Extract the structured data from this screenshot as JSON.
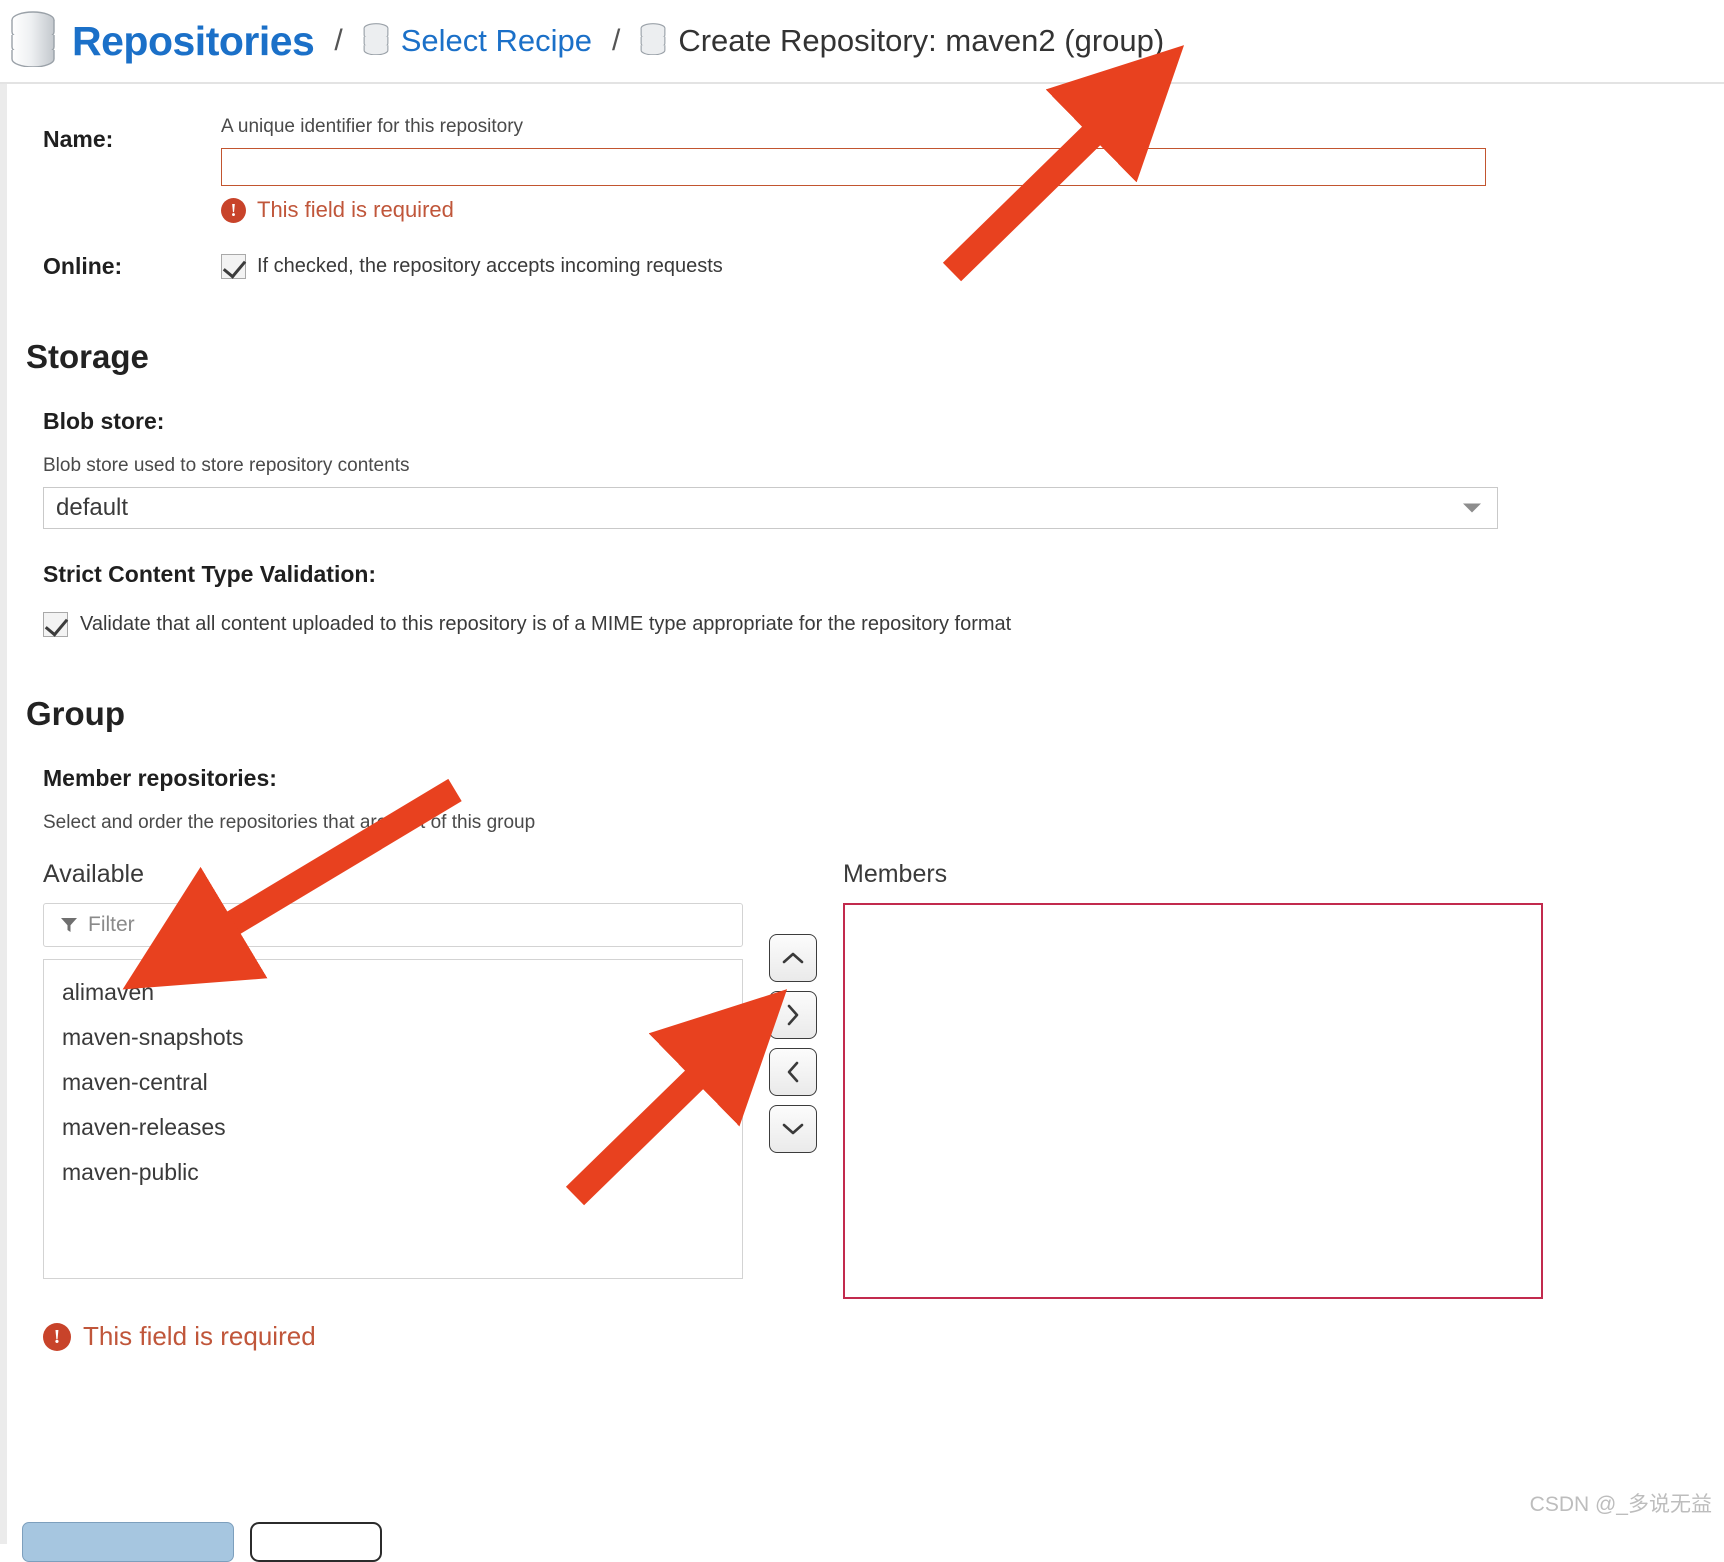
{
  "breadcrumb": {
    "root": "Repositories",
    "separator": "/",
    "link": "Select Recipe",
    "current": "Create Repository: maven2 (group)"
  },
  "form": {
    "name": {
      "label": "Name:",
      "hint": "A unique identifier for this repository",
      "value": "",
      "placeholder": "",
      "error": "This field is required"
    },
    "online": {
      "label": "Online:",
      "checkbox_text": "If checked, the repository accepts incoming requests",
      "checked": true
    }
  },
  "storage": {
    "heading": "Storage",
    "blob_store": {
      "label": "Blob store:",
      "hint": "Blob store used to store repository contents",
      "selected": "default",
      "options": [
        "default"
      ]
    },
    "strict": {
      "label": "Strict Content Type Validation:",
      "checkbox_text": "Validate that all content uploaded to this repository is of a MIME type appropriate for the repository format",
      "checked": true
    }
  },
  "group": {
    "heading": "Group",
    "member_label": "Member repositories:",
    "member_hint": "Select and order the repositories that are part of this group",
    "available": {
      "title": "Available",
      "filter_placeholder": "Filter",
      "filter_value": "",
      "items": [
        "alimaven",
        "maven-snapshots",
        "maven-central",
        "maven-releases",
        "maven-public"
      ]
    },
    "members": {
      "title": "Members",
      "items": []
    },
    "buttons": {
      "move_up": "^",
      "move_right": ">",
      "move_left": "<",
      "move_down": "v"
    },
    "error": "This field is required"
  },
  "footer": {
    "primary_label": "",
    "secondary_label": ""
  },
  "colors": {
    "link_blue": "#1b70c8",
    "error_red": "#c0563a",
    "error_icon": "#c8432a",
    "members_border": "#c22a4d",
    "name_border": "#c2552f",
    "arrow_red": "#e8411f"
  },
  "watermark": "CSDN @_多说无益"
}
